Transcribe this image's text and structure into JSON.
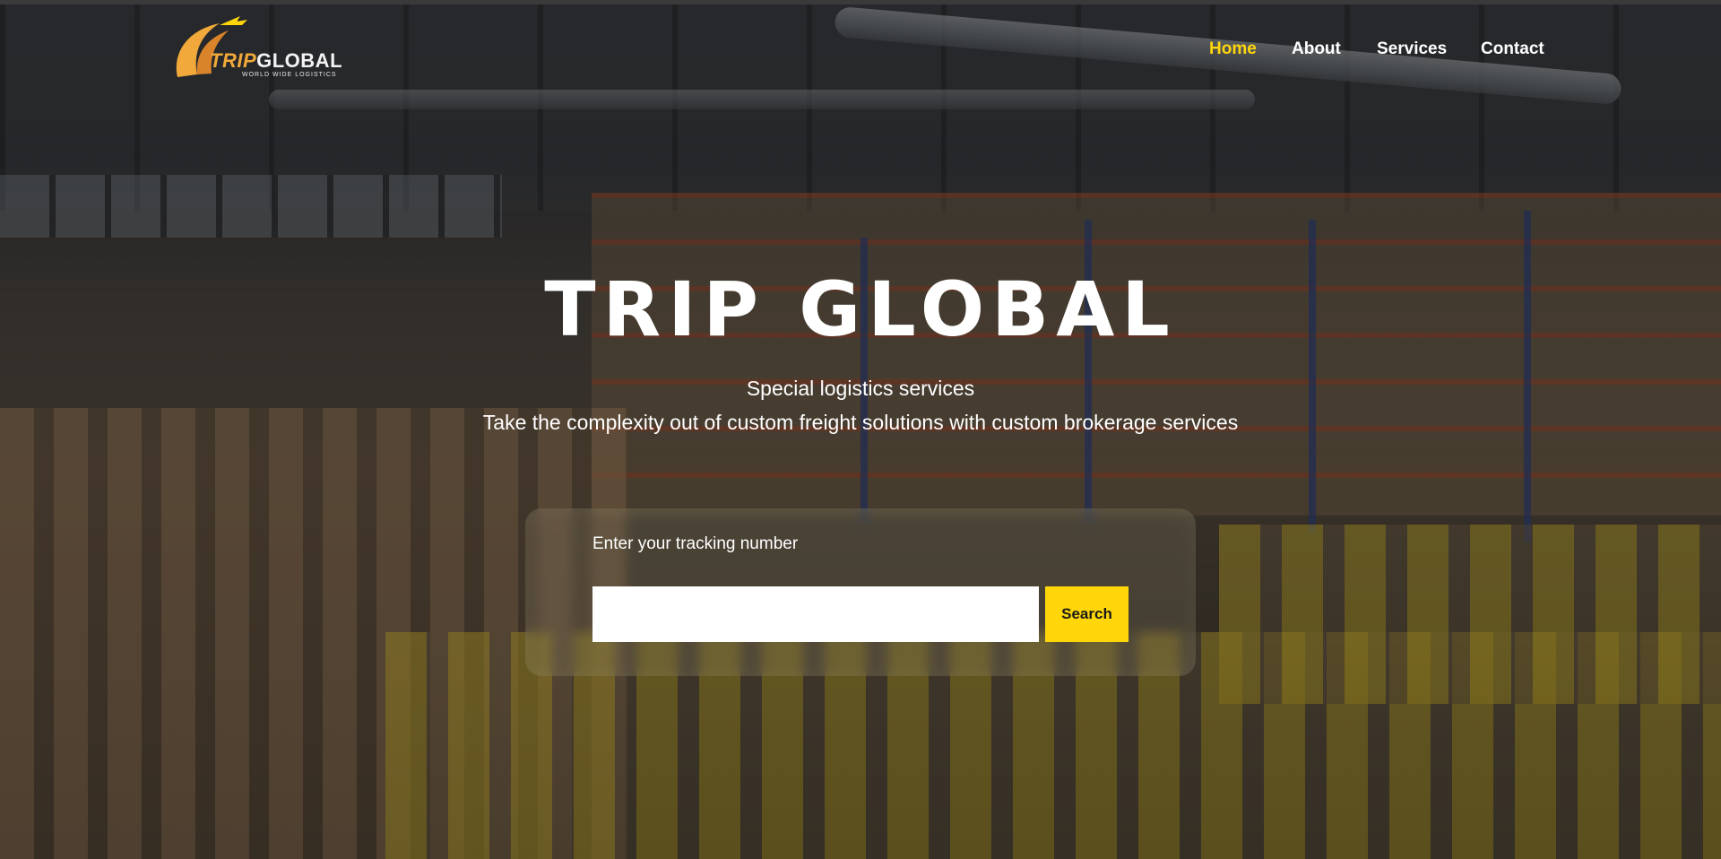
{
  "brand": {
    "name_part1": "TRIP",
    "name_part2": "GLOBAL",
    "tagline": "WORLD WIDE LOGISTICS",
    "accent_color": "#ffd60a",
    "logo_orange": "#f0a93a"
  },
  "nav": {
    "items": [
      {
        "label": "Home",
        "active": true
      },
      {
        "label": "About",
        "active": false
      },
      {
        "label": "Services",
        "active": false
      },
      {
        "label": "Contact",
        "active": false
      }
    ]
  },
  "hero": {
    "title": "TRIP GLOBAL",
    "subtitle": "Special logistics services",
    "tagline": "Take the complexity out of custom freight solutions with custom brokerage services"
  },
  "tracking": {
    "label": "Enter your tracking number",
    "input_value": "",
    "button_label": "Search"
  }
}
